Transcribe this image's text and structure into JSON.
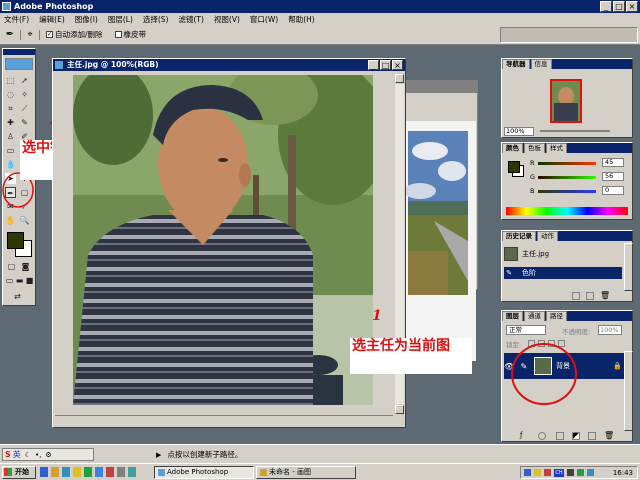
{
  "app": {
    "title": "Adobe Photoshop"
  },
  "menu": [
    "文件(F)",
    "编辑(E)",
    "图像(I)",
    "图层(L)",
    "选择(S)",
    "滤镜(T)",
    "视图(V)",
    "窗口(W)",
    "帮助(H)"
  ],
  "options": {
    "auto_add_delete": "自动添加/删除",
    "rubber_band": "橡皮带"
  },
  "doc": {
    "title": "主任.jpg @ 100%(RGB)"
  },
  "annotations": {
    "step2_number": "2",
    "step2_text": "选中钢笔工具",
    "step1_number": "1",
    "step1_text": "选主任为当前图"
  },
  "navigator": {
    "tabs": [
      "导航器",
      "信息"
    ],
    "zoom": "100%"
  },
  "color": {
    "tabs": [
      "颜色",
      "色板",
      "样式"
    ],
    "channels": [
      {
        "label": "R",
        "value": "45"
      },
      {
        "label": "G",
        "value": "56"
      },
      {
        "label": "B",
        "value": "0"
      }
    ]
  },
  "history": {
    "tabs": [
      "历史记录",
      "动作"
    ],
    "items": [
      "主任.jpg",
      "色阶"
    ]
  },
  "layers": {
    "tabs": [
      "图层",
      "通道",
      "路径"
    ],
    "blend_mode": "正常",
    "opacity_label": "不透明度:",
    "opacity_value": "100%",
    "lock_label": "锁定:",
    "layer_name": "背景"
  },
  "status": {
    "hint": "点按以创建新子路径。"
  },
  "ime": {
    "label": "英"
  },
  "taskbar": {
    "start": "开始",
    "buttons": [
      "Adobe Photoshop",
      "未命名 - 画图"
    ],
    "clock": "16:43"
  },
  "colors": {
    "titlebar": "#0a246a",
    "workspace": "#5e6a73",
    "annotation_red": "#e01010",
    "foreground_swatch": "#2d3800"
  }
}
